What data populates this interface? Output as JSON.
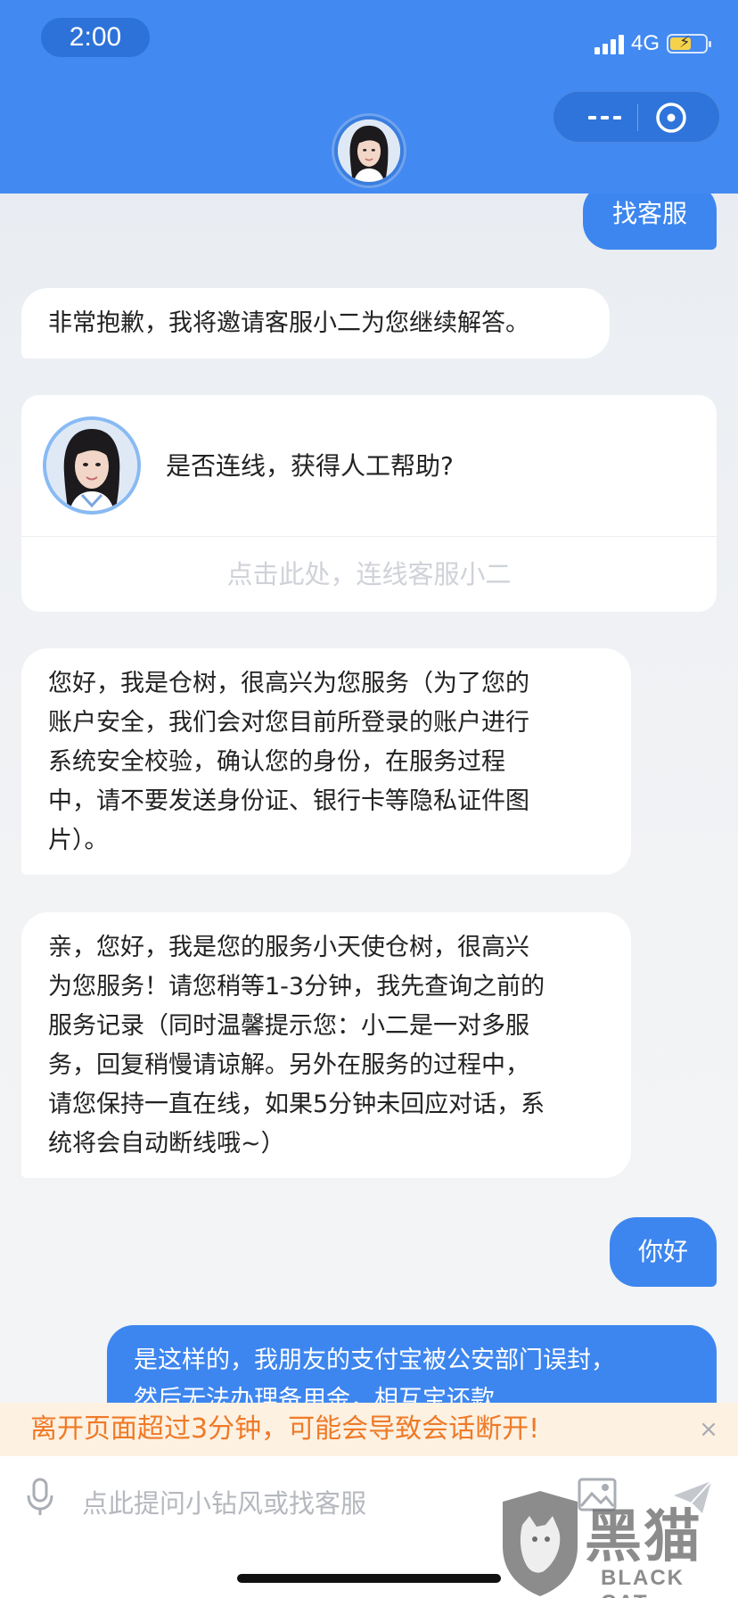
{
  "status_bar": {
    "time": "2:00",
    "network": "4G",
    "signal_level": 4,
    "battery_level": 0.6
  },
  "header": {
    "menu_icon": "more-dots-icon",
    "close_icon": "close-circle-icon"
  },
  "messages": {
    "user_1": "找客服",
    "bot_1": "非常抱歉，我将邀请客服小二为您继续解答。",
    "card": {
      "question": "是否连线，获得人工帮助?",
      "link_label": "点击此处，连线客服小二"
    },
    "bot_2_lines": [
      "您好，我是仓树，很高兴为您服务（为了您的",
      "账户安全，我们会对您目前所登录的账户进行",
      "系统安全校验，确认您的身份，在服务过程",
      "中，请不要发送身份证、银行卡等隐私证件图",
      "片）。"
    ],
    "bot_3_lines": [
      "亲，您好，我是您的服务小天使仓树，很高兴",
      "为您服务！请您稍等1-3分钟，我先查询之前的",
      "服务记录（同时温馨提示您：小二是一对多服",
      "务，回复稍慢请谅解。另外在服务的过程中，",
      "请您保持一直在线，如果5分钟未回应对话，系",
      "统将会自动断线哦~）"
    ],
    "user_2": "你好",
    "user_3_lines": [
      "是这样的，我朋友的支付宝被公安部门误封，",
      "然后无法办理备用金，相互宝还款"
    ]
  },
  "warning": {
    "text": "离开页面超过3分钟，可能会导致会话断开!",
    "close": "×"
  },
  "input": {
    "placeholder": "点此提问小钻风或找客服"
  },
  "watermark": {
    "title": "黑猫",
    "subtitle": "BLACK CAT"
  },
  "colors": {
    "header": "#4289f1",
    "user_bubble": "#3d86ef",
    "warning_text": "#ef7a27",
    "warning_bg": "#fdf1e2"
  }
}
